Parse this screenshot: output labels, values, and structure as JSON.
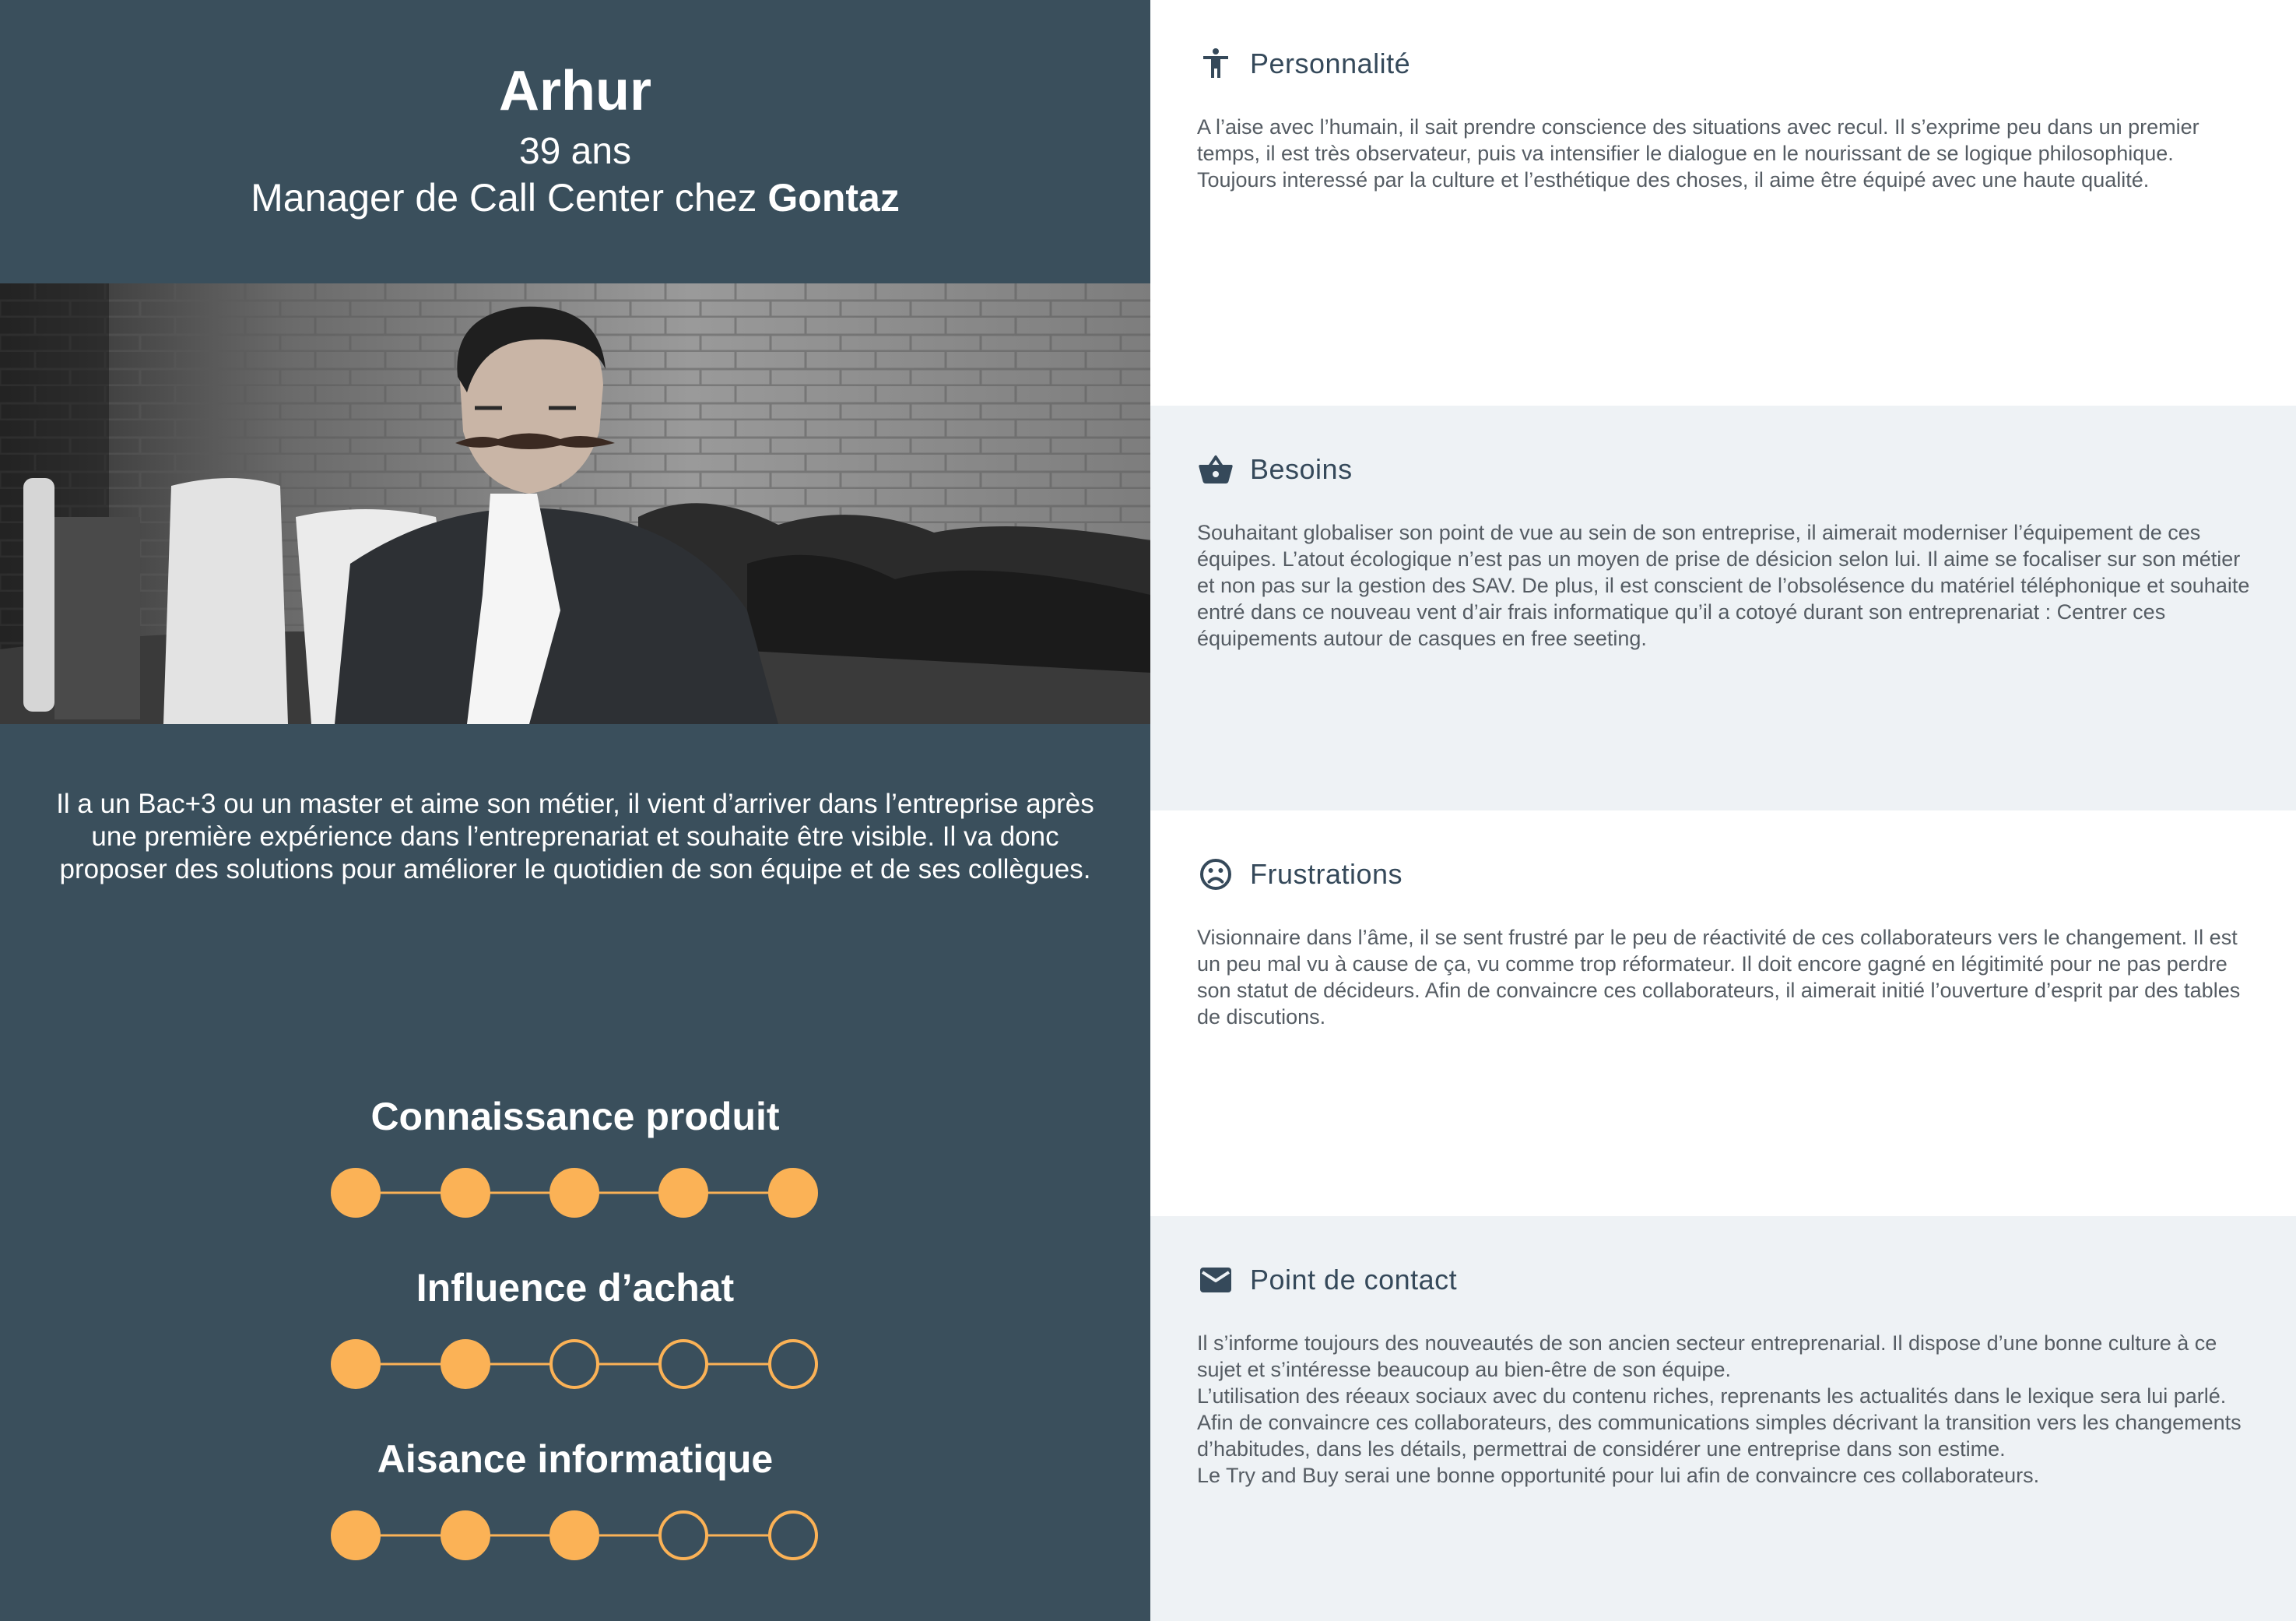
{
  "profile": {
    "name": "Arhur",
    "age": "39 ans",
    "role_prefix": "Manager de Call Center chez ",
    "company": "Gontaz",
    "bio": "Il a un Bac+3 ou un master et aime son métier, il vient d’arriver dans l’entreprise après une première expérience dans l’entreprenariat et souhaite être visible. Il va donc proposer des solutions pour améliorer le quotidien de son équipe et de ses collègues."
  },
  "skills": [
    {
      "label": "Connaissance produit",
      "level": 5,
      "max": 5
    },
    {
      "label": "Influence d’achat",
      "level": 2,
      "max": 5
    },
    {
      "label": "Aisance informatique",
      "level": 3,
      "max": 5
    }
  ],
  "sections": [
    {
      "icon": "accessibility-person-icon",
      "title": "Personnalité",
      "text": "A l’aise avec l’humain, il sait prendre conscience des situations avec recul. Il s’exprime peu dans un premier temps, il est très observateur, puis va intensifier le dialogue en le nourissant de se logique philosophique.\nToujours interessé par la culture et l’esthétique des choses, il aime être équipé avec une haute qualité."
    },
    {
      "icon": "shopping-basket-icon",
      "title": "Besoins",
      "text": "Souhaitant globaliser son point de vue au sein de son entreprise, il aimerait moderniser l’équipement de ces équipes. L’atout écologique n’est pas un moyen de prise de désicion selon lui. Il aime se focaliser sur son métier et non pas sur la gestion des SAV. De plus, il est conscient de l’obsolésence du matériel téléphonique et souhaite entré dans ce nouveau vent d’air frais informatique qu’il a cotoyé durant son entreprenariat : Centrer ces équipements autour de casques en free seeting."
    },
    {
      "icon": "sad-face-icon",
      "title": "Frustrations",
      "text": "Visionnaire dans l’âme, il se sent frustré par le peu de réactivité de ces collaborateurs vers le changement. Il est un peu mal vu à cause de ça, vu comme trop réformateur. Il doit encore gagné en légitimité pour ne pas perdre son statut de décideurs. Afin de convaincre ces collaborateurs, il aimerait initié l’ouverture d’esprit par des tables de discutions."
    },
    {
      "icon": "mail-envelope-icon",
      "title": "Point de contact",
      "text": "Il s’informe toujours des nouveautés de son ancien secteur entreprenarial. Il dispose d’une bonne culture à ce sujet et s’intéresse beaucoup au bien-être de son équipe.\nL’utilisation des réeaux sociaux avec du contenu riches, reprenants les actualités dans le lexique sera lui parlé.\nAfin de convaincre ces collaborateurs, des communications simples décrivant la transition vers les changements d’habitudes, dans les détails, permettrai de considérer une entreprise dans son estime.\nLe Try and Buy serai une bonne opportunité pour lui afin de convaincre ces collaborateurs."
    }
  ],
  "colors": {
    "panel": "#3a4f5c",
    "accent": "#fbb256",
    "alt_section": "#eef2f5",
    "heading": "#35495a",
    "body_text": "#555c63"
  }
}
